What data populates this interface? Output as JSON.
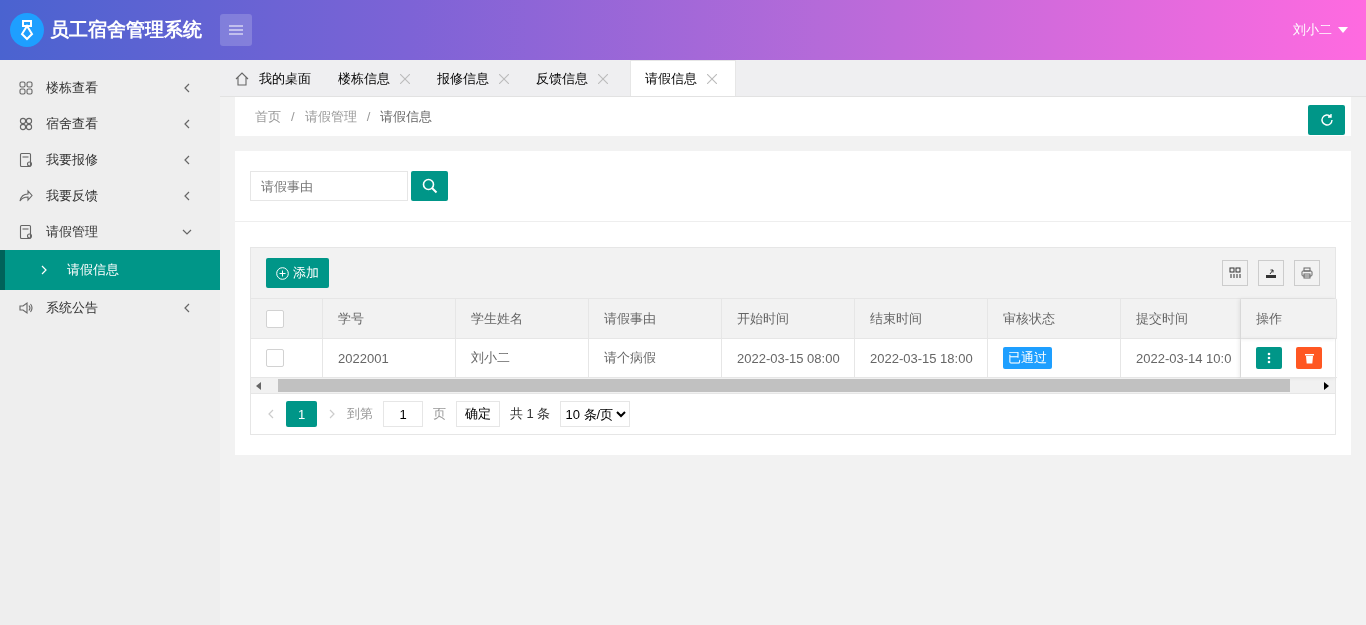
{
  "header": {
    "title": "员工宿舍管理系统",
    "user": "刘小二"
  },
  "sidebar": {
    "items": [
      {
        "label": "楼栋查看",
        "expanded": false
      },
      {
        "label": "宿舍查看",
        "expanded": false
      },
      {
        "label": "我要报修",
        "expanded": false
      },
      {
        "label": "我要反馈",
        "expanded": false
      },
      {
        "label": "请假管理",
        "expanded": true,
        "children": [
          {
            "label": "请假信息",
            "selected": true
          }
        ]
      },
      {
        "label": "系统公告",
        "expanded": false
      }
    ]
  },
  "tabs": [
    {
      "label": "我的桌面",
      "kind": "home",
      "selected": false
    },
    {
      "label": "楼栋信息",
      "kind": "closable",
      "selected": false
    },
    {
      "label": "报修信息",
      "kind": "closable",
      "selected": false
    },
    {
      "label": "反馈信息",
      "kind": "closable",
      "selected": false
    },
    {
      "label": "请假信息",
      "kind": "closable",
      "selected": true
    }
  ],
  "breadcrumb": [
    "首页",
    "/",
    "请假管理",
    "/",
    "请假信息"
  ],
  "search": {
    "placeholder": "请假事由"
  },
  "toolbar": {
    "add_label": "添加"
  },
  "table": {
    "all_checked": false,
    "columns": [
      "学号",
      "学生姓名",
      "请假事由",
      "开始时间",
      "结束时间",
      "审核状态",
      "提交时间",
      "操作"
    ],
    "rows": [
      {
        "checked": false,
        "cells": [
          "2022001",
          "刘小二",
          "请个病假",
          "2022-03-15 08:00",
          "2022-03-15 18:00"
        ],
        "status": "已通过",
        "submitted": "2022-03-14 10:0"
      }
    ]
  },
  "pagination": {
    "current": "1",
    "goto_label": "到第",
    "page_value": "1",
    "page_label": "页",
    "confirm": "确定",
    "total": "共 1 条",
    "page_size": "10 条/页"
  }
}
